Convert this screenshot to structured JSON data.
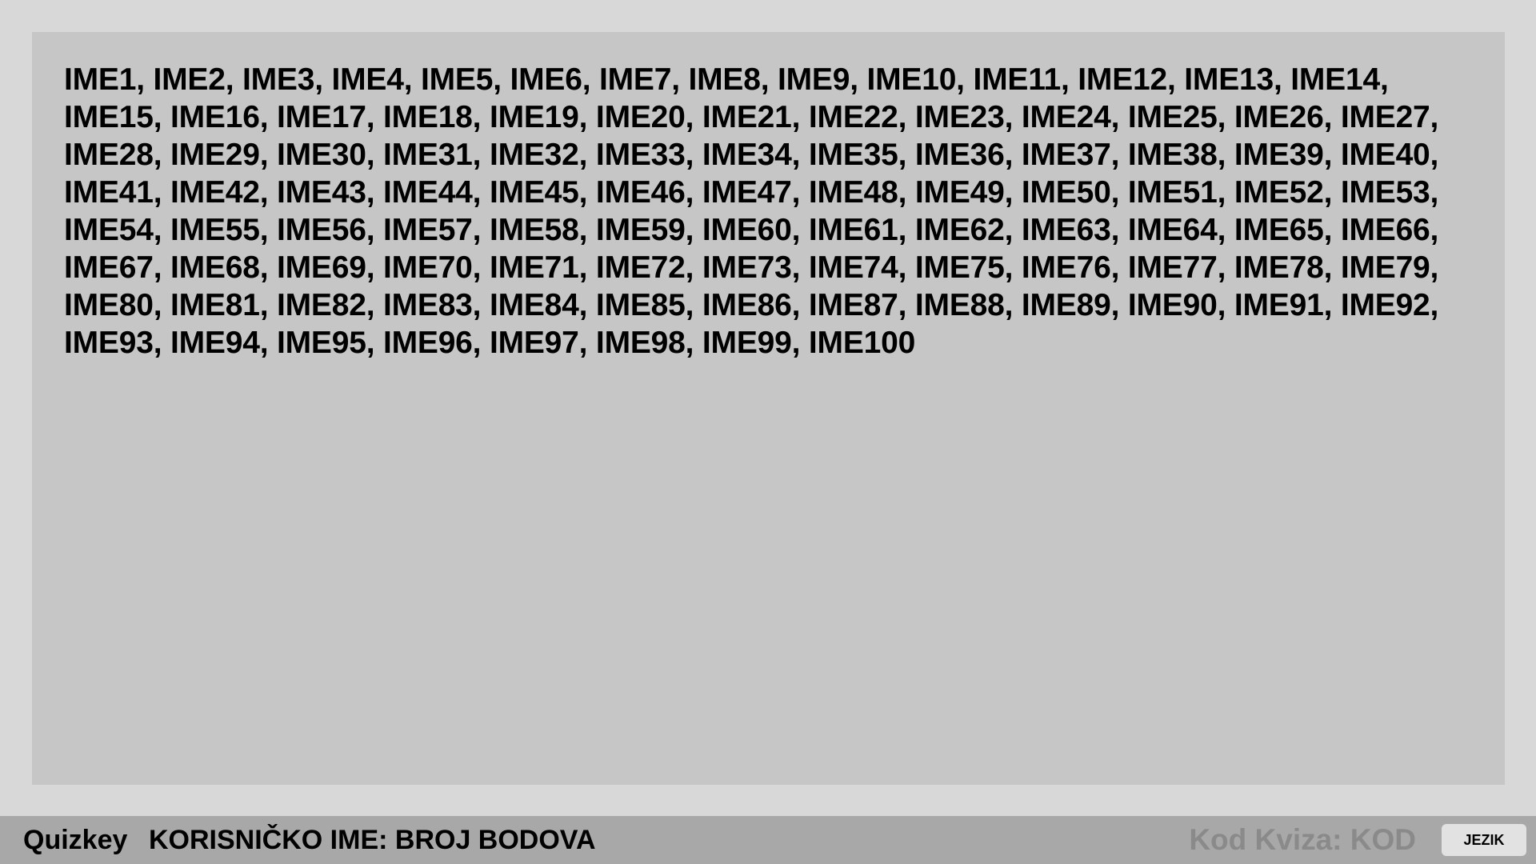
{
  "main": {
    "names_text": "IME1, IME2, IME3, IME4, IME5, IME6, IME7, IME8, IME9, IME10, IME11, IME12, IME13, IME14, IME15, IME16, IME17, IME18, IME19, IME20, IME21, IME22, IME23, IME24, IME25, IME26, IME27, IME28, IME29, IME30, IME31, IME32, IME33, IME34, IME35, IME36, IME37, IME38, IME39, IME40, IME41, IME42, IME43, IME44, IME45, IME46, IME47, IME48, IME49, IME50, IME51, IME52, IME53, IME54, IME55, IME56, IME57, IME58, IME59, IME60, IME61, IME62, IME63, IME64, IME65, IME66, IME67, IME68, IME69, IME70, IME71, IME72, IME73, IME74, IME75, IME76, IME77, IME78, IME79, IME80, IME81, IME82, IME83, IME84, IME85, IME86, IME87, IME88, IME89, IME90, IME91, IME92, IME93, IME94, IME95, IME96, IME97, IME98, IME99, IME100"
  },
  "footer": {
    "brand": "Quizkey",
    "user_score": "KORISNIČKO IME: BROJ BODOVA",
    "quiz_code": "Kod Kviza: KOD",
    "language_button": "JEZIK"
  },
  "colors": {
    "page_background": "#d8d8d8",
    "panel_background": "#c6c6c6",
    "footer_background": "#a8a8a8",
    "quiz_code_text": "#8a8a8a",
    "button_background": "#e2e2e2"
  }
}
